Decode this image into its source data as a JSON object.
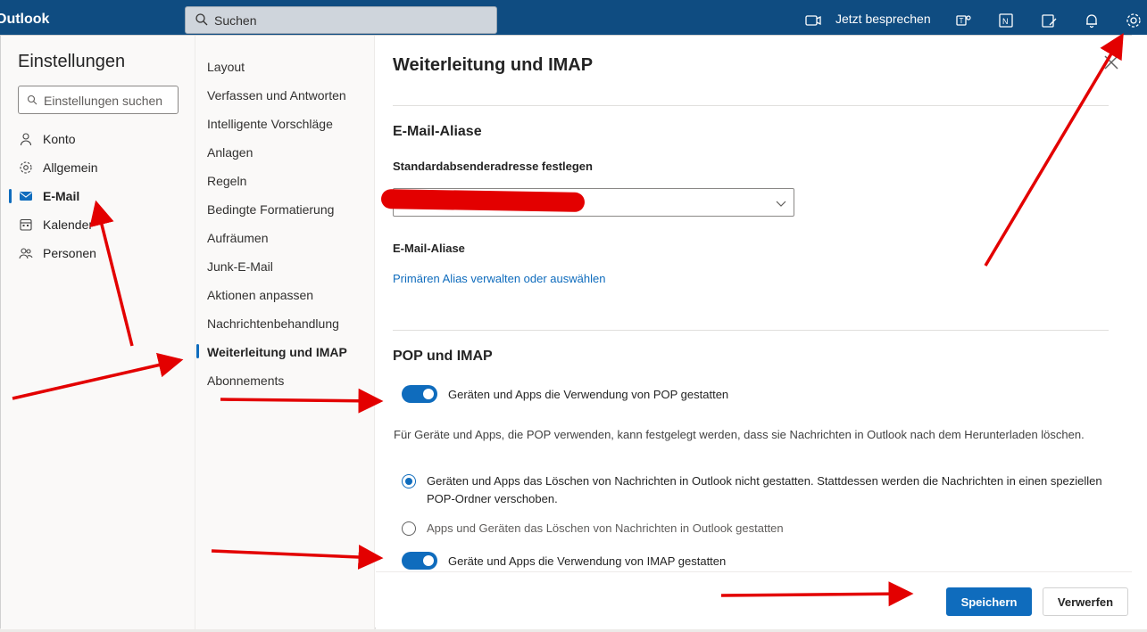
{
  "app": {
    "brand": "Outlook",
    "search_placeholder": "Suchen",
    "meet_now": "Jetzt besprechen"
  },
  "settings": {
    "title": "Einstellungen",
    "search_placeholder": "Einstellungen suchen",
    "categories": [
      {
        "label": "Konto",
        "icon": "person-icon"
      },
      {
        "label": "Allgemein",
        "icon": "gear-icon"
      },
      {
        "label": "E-Mail",
        "icon": "mail-icon",
        "selected": true
      },
      {
        "label": "Kalender",
        "icon": "calendar-icon"
      },
      {
        "label": "Personen",
        "icon": "people-icon"
      }
    ],
    "subcategories": [
      "Layout",
      "Verfassen und Antworten",
      "Intelligente Vorschläge",
      "Anlagen",
      "Regeln",
      "Bedingte Formatierung",
      "Aufräumen",
      "Junk-E-Mail",
      "Aktionen anpassen",
      "Nachrichtenbehandlung",
      "Weiterleitung und IMAP",
      "Abonnements"
    ],
    "selected_subcategory": "Weiterleitung und IMAP"
  },
  "page": {
    "title": "Weiterleitung und IMAP",
    "alias_section": {
      "heading": "E-Mail-Aliase",
      "default_sender_label": "Standardabsenderadresse festlegen",
      "aliases_label": "E-Mail-Aliase",
      "manage_link": "Primären Alias verwalten oder auswählen"
    },
    "pop_imap_section": {
      "heading": "POP und IMAP",
      "pop_toggle_label": "Geräten und Apps die Verwendung von POP gestatten",
      "pop_toggle_on": true,
      "pop_description": "Für Geräte und Apps, die POP verwenden, kann festgelegt werden, dass sie Nachrichten in Outlook nach dem Herunterladen löschen.",
      "radio_options": [
        {
          "label": "Geräten und Apps das Löschen von Nachrichten in Outlook nicht gestatten. Stattdessen werden die Nachrichten in einen speziellen POP-Ordner verschoben.",
          "checked": true
        },
        {
          "label": "Apps und Geräten das Löschen von Nachrichten in Outlook gestatten",
          "checked": false
        }
      ],
      "imap_toggle_label": "Geräte und Apps die Verwendung von IMAP gestatten",
      "imap_toggle_on": true
    }
  },
  "footer": {
    "save_label": "Speichern",
    "discard_label": "Verwerfen"
  },
  "colors": {
    "topbar": "#0f4c81",
    "accent": "#0f6cbd",
    "annotation_red": "#e30000"
  }
}
